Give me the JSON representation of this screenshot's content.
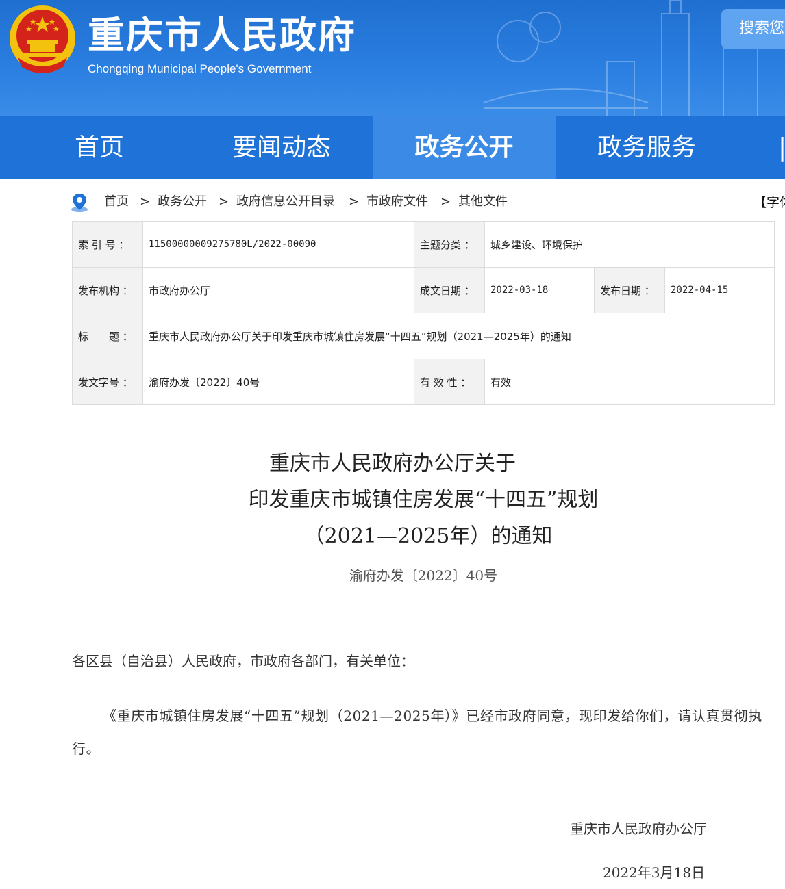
{
  "header": {
    "site_title": "重庆市人民政府",
    "site_subtitle": "Chongqing Municipal People's Government",
    "search_label": "搜索您"
  },
  "nav": {
    "items": [
      {
        "label": "首页"
      },
      {
        "label": "要闻动态"
      },
      {
        "label": "政务公开",
        "active": true
      },
      {
        "label": "政务服务"
      }
    ]
  },
  "breadcrumb": {
    "items": [
      "首页",
      "政务公开",
      "政府信息公开目录",
      "市政府文件",
      "其他文件"
    ],
    "separator": ">",
    "font_size_label": "【字体"
  },
  "info": {
    "index_label": "索 引 号 ：",
    "index_value": "11500000009275780L/2022-00090",
    "topic_label": "主题分类 ：",
    "topic_value": "城乡建设、环境保护",
    "issuer_label": "发布机构 ：",
    "issuer_value": "市政府办公厅",
    "created_label": "成文日期 ：",
    "created_value": "2022-03-18",
    "published_label": "发布日期 ：",
    "published_value": "2022-04-15",
    "title_label": "标　　题 ：",
    "title_value": "重庆市人民政府办公厅关于印发重庆市城镇住房发展“十四五”规划（2021—2025年）的通知",
    "docno_label": "发文字号 ：",
    "docno_value": "渝府办发〔2022〕40号",
    "validity_label": "有 效 性 ：",
    "validity_value": "有效"
  },
  "article": {
    "title_line1": "重庆市人民政府办公厅关于",
    "title_line2": "印发重庆市城镇住房发展“十四五”规划",
    "title_line3": "（2021—2025年）的通知",
    "doc_number": "渝府办发〔2022〕40号",
    "salutation": "各区县（自治县）人民政府，市政府各部门，有关单位：",
    "body": "《重庆市城镇住房发展“十四五”规划（2021—2025年）》已经市政府同意，现印发给你们，请认真贯彻执行。",
    "signature": "重庆市人民政府办公厅",
    "date": "2022年3月18日"
  },
  "colors": {
    "banner": "#1f6fd0",
    "nav": "#1f73d8",
    "nav_active": "#3a8ae6",
    "emblem_red": "#d4231a",
    "emblem_gold": "#f3c20f"
  }
}
